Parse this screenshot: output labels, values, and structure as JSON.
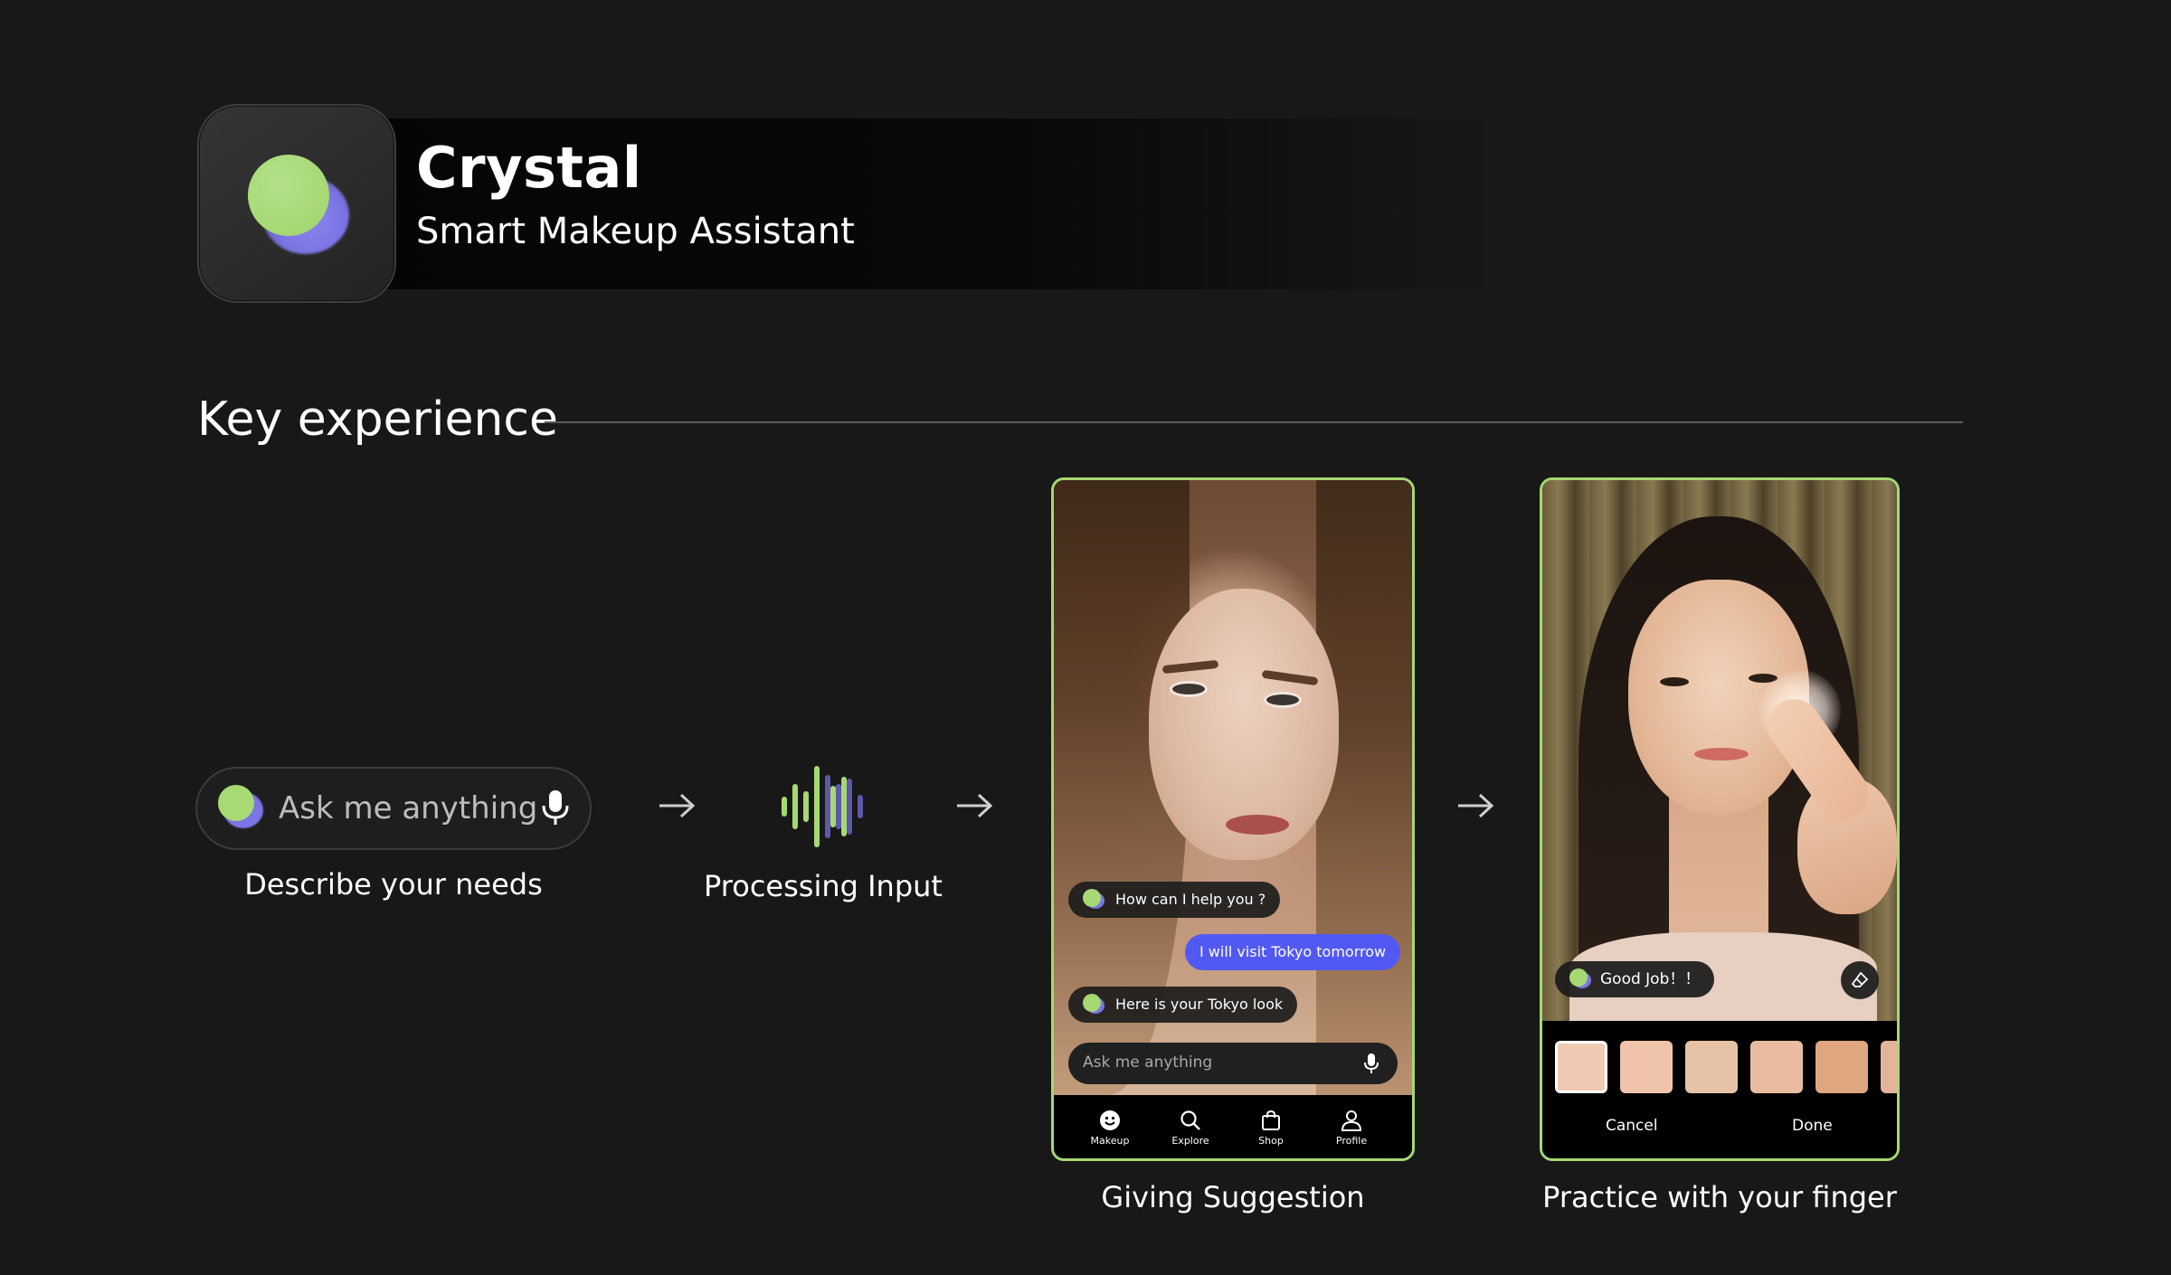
{
  "header": {
    "app_name": "Crystal",
    "subtitle": "Smart Makeup Assistant"
  },
  "section": {
    "title": "Key experience"
  },
  "steps": [
    {
      "caption": "Describe your needs"
    },
    {
      "caption": "Processing Input"
    },
    {
      "caption": "Giving Suggestion"
    },
    {
      "caption": "Practice with your finger"
    }
  ],
  "input_pill": {
    "placeholder": "Ask me anything"
  },
  "chat": {
    "messages": [
      {
        "from": "assistant",
        "text": "How can I help you ?"
      },
      {
        "from": "user",
        "text": "I will visit Tokyo tomorrow"
      },
      {
        "from": "assistant",
        "text": "Here is your Tokyo look"
      }
    ],
    "input_placeholder": "Ask me anything"
  },
  "bottom_nav": {
    "items": [
      {
        "label": "Makeup",
        "icon": "smiley-icon"
      },
      {
        "label": "Explore",
        "icon": "search-icon"
      },
      {
        "label": "Shop",
        "icon": "shopping-bag-icon"
      },
      {
        "label": "Profile",
        "icon": "profile-icon"
      }
    ]
  },
  "practice": {
    "feedback": "Good Job！！",
    "swatch_colors": [
      "#efc9b2",
      "#f0c4aa",
      "#e6c2a6",
      "#e9bca2",
      "#dfa67f",
      "#e2b59a"
    ],
    "selected_swatch": 0,
    "cancel_label": "Cancel",
    "done_label": "Done"
  },
  "colors": {
    "accent_green": "#a6d873",
    "accent_purple": "#7b75e6",
    "user_bubble_blue": "#5259f2",
    "background": "#181818"
  }
}
